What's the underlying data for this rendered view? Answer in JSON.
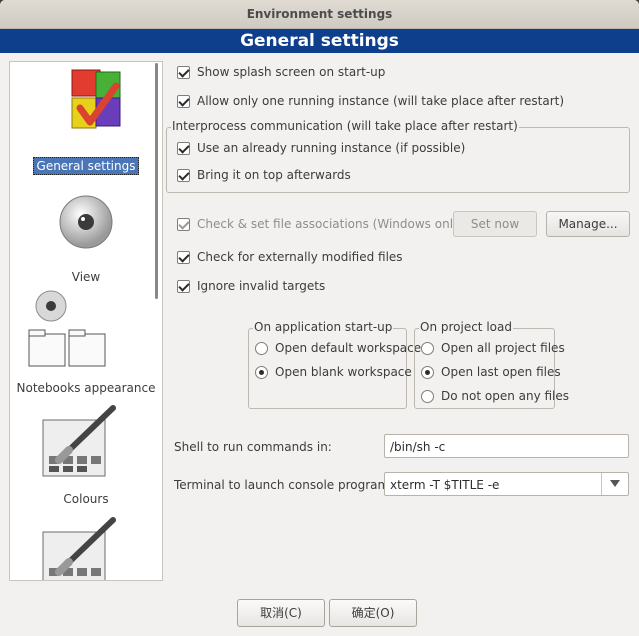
{
  "window": {
    "title": "Environment settings"
  },
  "header": {
    "title": "General settings"
  },
  "sidebar": {
    "items": [
      {
        "label": "General settings",
        "icon": "general-settings-icon",
        "selected": true
      },
      {
        "label": "View",
        "icon": "eye-icon"
      },
      {
        "label": "Notebooks appearance",
        "icon": "notebooks-icon"
      },
      {
        "label": "Colours",
        "icon": "palette-brush-icon"
      },
      {
        "label": "",
        "icon": "palette-brush-icon"
      }
    ]
  },
  "options": {
    "splash": "Show splash screen on start-up",
    "single_instance": "Allow only one running instance (will take place after restart)",
    "ipc_group": "Interprocess communication (will take place after restart)",
    "use_running": "Use an already running instance (if possible)",
    "bring_top": "Bring it on top afterwards",
    "file_assoc": "Check & set file associations (Windows only)",
    "set_now": "Set now",
    "manage": "Manage...",
    "ext_modified": "Check for externally modified files",
    "ignore_invalid": "Ignore invalid targets"
  },
  "startup": {
    "title": "On application start-up",
    "default_ws": "Open default workspace",
    "blank_ws": "Open blank workspace",
    "selected": "blank_ws"
  },
  "project_load": {
    "title": "On project load",
    "all_files": "Open all project files",
    "last_open": "Open last open files",
    "no_files": "Do not open any files",
    "selected": "last_open"
  },
  "shell": {
    "label": "Shell to run commands in:",
    "value": "/bin/sh -c"
  },
  "terminal": {
    "label": "Terminal to launch console programs:",
    "value": "xterm -T $TITLE -e"
  },
  "footer": {
    "cancel": "取消(C)",
    "ok": "确定(O)"
  },
  "colors": {
    "accent": "#0d3f8c",
    "selection": "#4a76b8"
  }
}
